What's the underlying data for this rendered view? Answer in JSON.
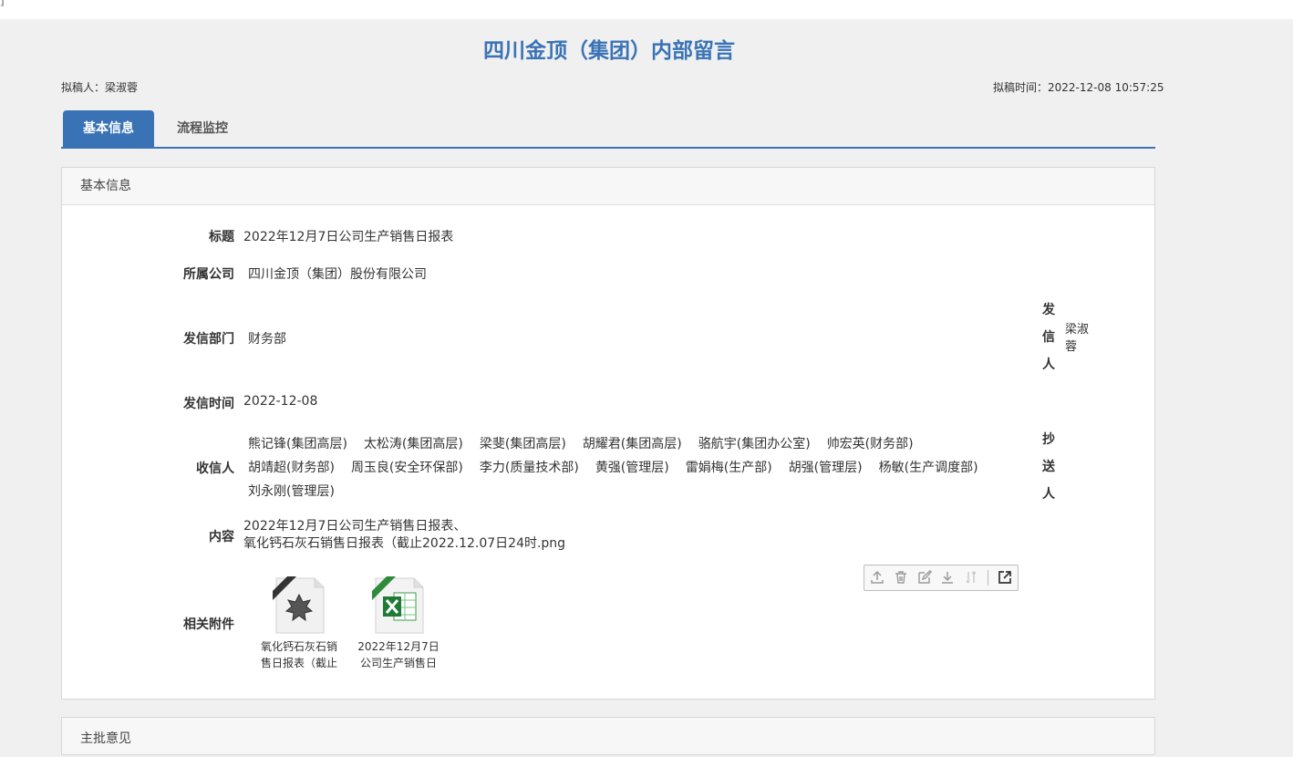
{
  "corner_mark": "]",
  "document": {
    "title": "四川金顶（集团）内部留言",
    "drafter_label": "拟稿人：",
    "drafter": "梁淑蓉",
    "draft_time_label": "拟稿时间：",
    "draft_time": "2022-12-08 10:57:25"
  },
  "tabs": [
    {
      "label": "基本信息",
      "active": true
    },
    {
      "label": "流程监控",
      "active": false
    }
  ],
  "basic_info": {
    "section_title": "基本信息",
    "fields": {
      "title": {
        "label": "标题",
        "value": "2022年12月7日公司生产销售日报表"
      },
      "company": {
        "label": "所属公司",
        "value": "四川金顶（集团）股份有限公司"
      },
      "department": {
        "label": "发信部门",
        "value": "财务部"
      },
      "send_date": {
        "label": "发信时间",
        "value": "2022-12-08"
      },
      "recipients_label": "收信人",
      "content_label": "内容",
      "attachments_label": "相关附件"
    },
    "sender": {
      "label_chars": [
        "发",
        "信",
        "人"
      ],
      "value": "梁淑蓉"
    },
    "cc": {
      "label_chars": [
        "抄",
        "送",
        "人"
      ]
    },
    "recipients": [
      "熊记锋(集团高层)",
      "太松涛(集团高层)",
      "梁斐(集团高层)",
      "胡耀君(集团高层)",
      "骆航宇(集团办公室)",
      "帅宏英(财务部)",
      "胡靖超(财务部)",
      "周玉良(安全环保部)",
      "李力(质量技术部)",
      "黄强(管理层)",
      "雷娟梅(生产部)",
      "胡强(管理层)",
      "杨敏(生产调度部)",
      "刘永刚(管理层)"
    ],
    "content_lines": [
      "2022年12月7日公司生产销售日报表、",
      "氧化钙石灰石销售日报表（截止2022.12.07日24时.png"
    ],
    "toolbar_icons": [
      "upload-icon",
      "delete-icon",
      "edit-icon",
      "download-icon",
      "sort-icon",
      "open-external-icon"
    ],
    "attachments": [
      {
        "type": "PNG",
        "name_line1": "氧化钙石灰石销",
        "name_line2": "售日报表（截止"
      },
      {
        "type": "XLSX",
        "name_line1": "2022年12月7日",
        "name_line2": "公司生产销售日"
      }
    ]
  },
  "next_section": {
    "title": "主批意见"
  },
  "colors": {
    "accent": "#3a73b5",
    "background": "#f0f0f0",
    "panel": "#ffffff"
  }
}
